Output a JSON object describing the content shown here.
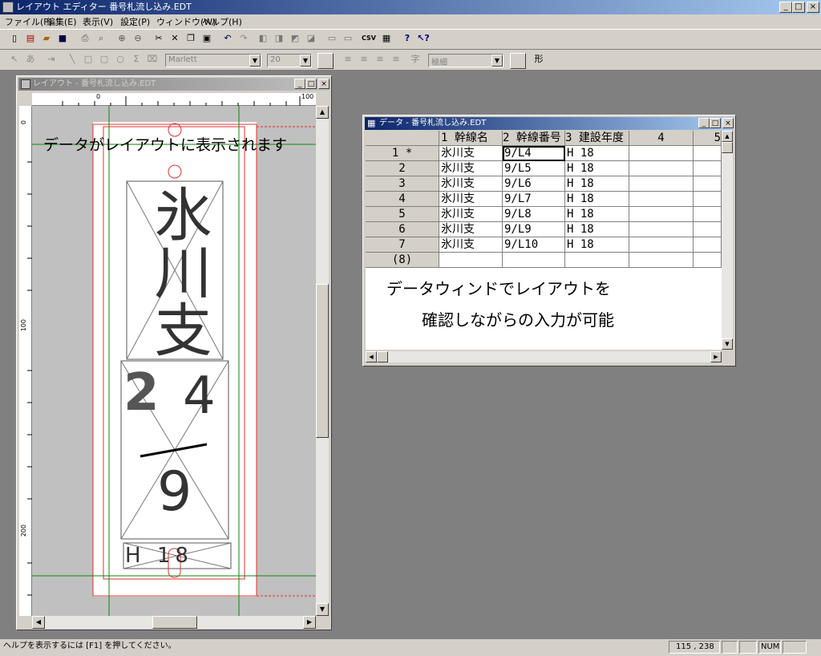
{
  "app": {
    "title": "レイアウト エディター 番号札流し込み.EDT",
    "menu": [
      "ファイル(F)",
      "編集(E)",
      "表示(V)",
      "設定(P)",
      "ウィンドウ(W)",
      "ヘルプ(H)"
    ]
  },
  "toolbar2": {
    "font_name": "Marlett",
    "font_size": "20",
    "weight": "極細",
    "katachi": "形",
    "ji": "字"
  },
  "layout_window": {
    "title": "レイアウト - 番号札流し込み.EDT",
    "ruler_top": [
      "0",
      "100"
    ],
    "ruler_left": [
      "0",
      "100",
      "200"
    ],
    "annotation": "データがレイアウトに表示されます",
    "big_text": "氷川支",
    "num_left": "2",
    "num_right": "4",
    "num_bottom": "9",
    "bottom_text": "H 18"
  },
  "data_window": {
    "title": "データ - 番号札流し込み.EDT",
    "columns": [
      "1 幹線名",
      "2 幹線番号",
      "3 建設年度",
      "4",
      "5"
    ],
    "rows": [
      {
        "num": "1 *",
        "c1": "氷川支",
        "c2": "9/L4",
        "c3": "H 18"
      },
      {
        "num": "2",
        "c1": "氷川支",
        "c2": "9/L5",
        "c3": "H 18"
      },
      {
        "num": "3",
        "c1": "氷川支",
        "c2": "9/L6",
        "c3": "H 18"
      },
      {
        "num": "4",
        "c1": "氷川支",
        "c2": "9/L7",
        "c3": "H 18"
      },
      {
        "num": "5",
        "c1": "氷川支",
        "c2": "9/L8",
        "c3": "H 18"
      },
      {
        "num": "6",
        "c1": "氷川支",
        "c2": "9/L9",
        "c3": "H 18"
      },
      {
        "num": "7",
        "c1": "氷川支",
        "c2": "9/L10",
        "c3": "H 18"
      },
      {
        "num": "(8)",
        "c1": "",
        "c2": "",
        "c3": ""
      }
    ],
    "note_line1": "データウィンドでレイアウトを",
    "note_line2": "確認しながらの入力が可能"
  },
  "status": {
    "help": "ヘルプを表示するには [F1] を押してください。",
    "coords": "115 , 238",
    "num": "NUM"
  }
}
